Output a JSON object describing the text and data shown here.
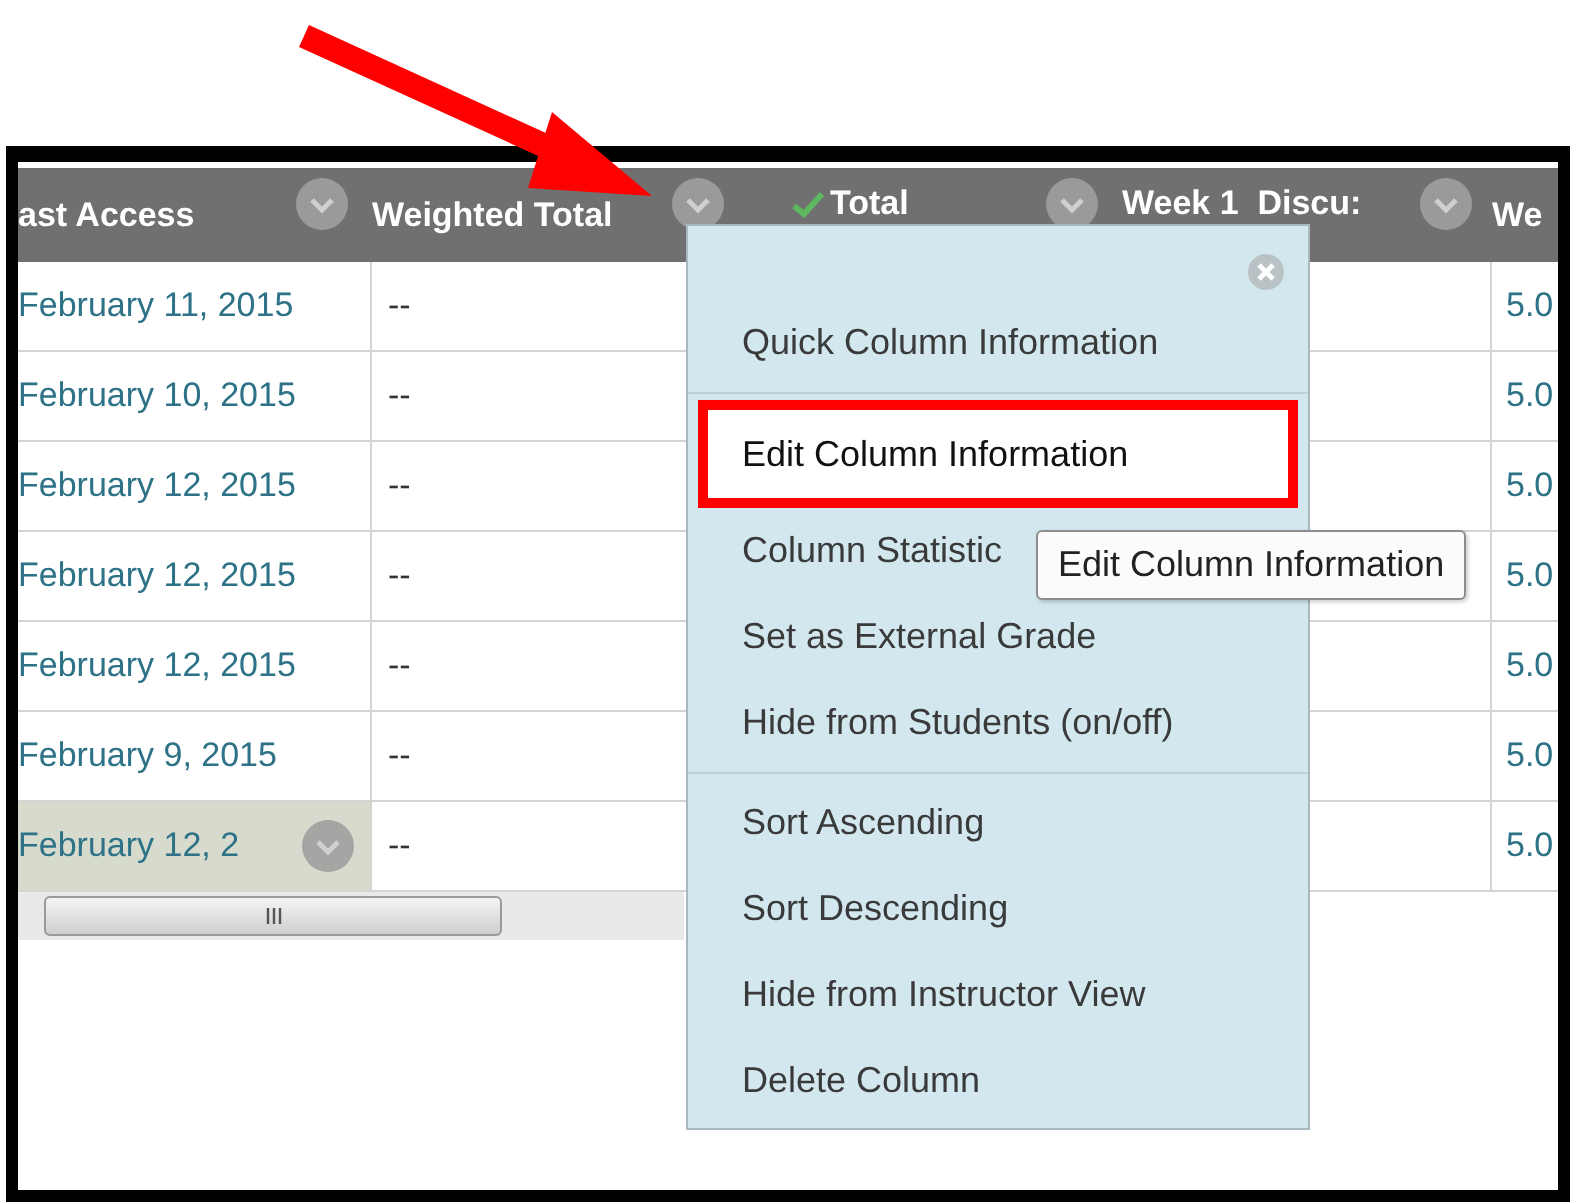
{
  "columns": [
    {
      "label": "ast Access",
      "kind": "plain"
    },
    {
      "label": "Weighted Total",
      "kind": "plain"
    },
    {
      "label": "Total",
      "kind": "check"
    },
    {
      "label": "Week 1  Discu:",
      "kind": "plain"
    },
    {
      "label": "We",
      "kind": "plain"
    }
  ],
  "rows": [
    {
      "last_access": "February 11, 2015",
      "weighted_total": "--",
      "column_5": "5.0",
      "selected": false
    },
    {
      "last_access": "February 10, 2015",
      "weighted_total": "--",
      "column_5": "5.0",
      "selected": false
    },
    {
      "last_access": "February 12, 2015",
      "weighted_total": "--",
      "column_5": "5.0",
      "selected": false
    },
    {
      "last_access": "February 12, 2015",
      "weighted_total": "--",
      "column_5": "5.0",
      "selected": false
    },
    {
      "last_access": "February 12, 2015",
      "weighted_total": "--",
      "column_5": "5.0",
      "selected": false
    },
    {
      "last_access": "February 9, 2015",
      "weighted_total": "--",
      "column_5": "5.0",
      "selected": false
    },
    {
      "last_access": "February 12, 2",
      "weighted_total": "--",
      "column_5": "5.0",
      "selected": true
    }
  ],
  "menu": {
    "items": [
      {
        "label": "Quick Column Information",
        "selected": false,
        "divider_before": false
      },
      {
        "label": "Edit Column Information",
        "selected": true,
        "divider_before": true
      },
      {
        "label": "Column Statistic",
        "selected": false,
        "divider_before": false
      },
      {
        "label": "Set as External Grade",
        "selected": false,
        "divider_before": false
      },
      {
        "label": "Hide from Students (on/off)",
        "selected": false,
        "divider_before": false
      },
      {
        "label": "Sort Ascending",
        "selected": false,
        "divider_before": true
      },
      {
        "label": "Sort Descending",
        "selected": false,
        "divider_before": false
      },
      {
        "label": "Hide from Instructor View",
        "selected": false,
        "divider_before": false
      },
      {
        "label": "Delete Column",
        "selected": false,
        "divider_before": false
      }
    ]
  },
  "tooltip": {
    "text": "Edit Column Information"
  }
}
